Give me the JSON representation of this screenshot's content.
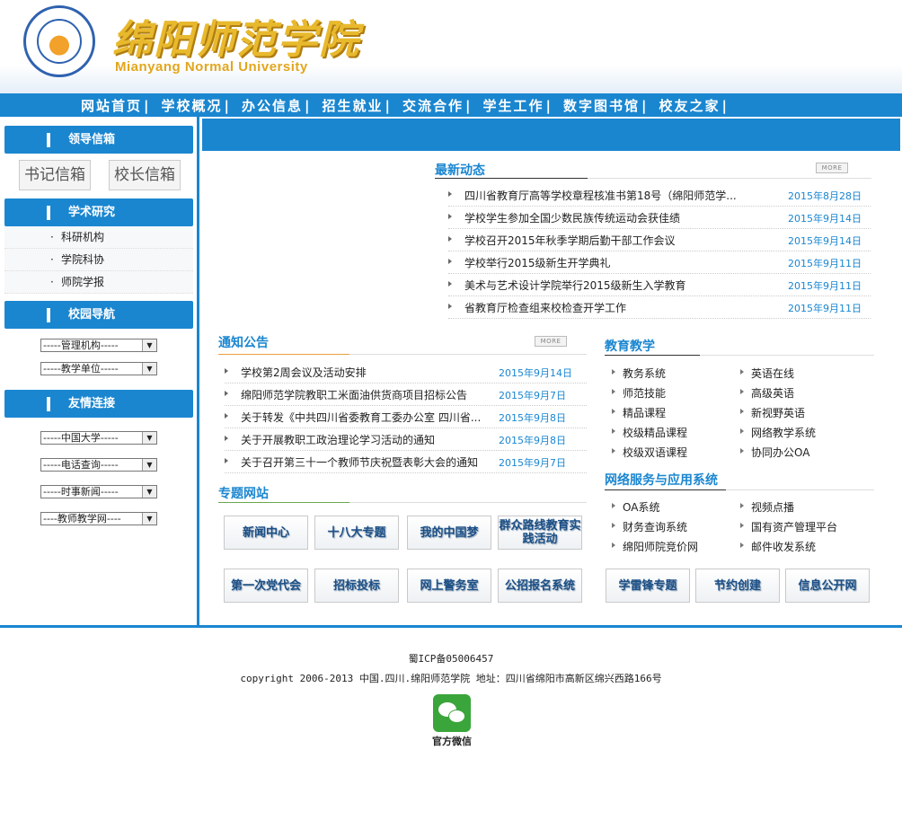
{
  "header": {
    "seal_text": "绵阳师范学院",
    "name_cn": "绵阳师范学院",
    "name_en": "Mianyang Normal University"
  },
  "nav": [
    "网站首页",
    "学校概况",
    "办公信息",
    "招生就业",
    "交流合作",
    "学生工作",
    "数字图书馆",
    "校友之家"
  ],
  "nav_separator": "|",
  "sidebar": {
    "leaders_title": "领导信箱",
    "mailbox_secretary": "书记信箱",
    "mailbox_president": "校长信箱",
    "research_title": "学术研究",
    "research_items": [
      "科研机构",
      "学院科协",
      "师院学报"
    ],
    "campus_nav_title": "校园导航",
    "campus_selects": [
      "-----管理机构-----",
      "-----教学单位-----"
    ],
    "links_title": "友情连接",
    "link_selects": [
      "-----中国大学-----",
      "-----电话查询-----",
      "-----时事新闻-----",
      "----教师教学网----"
    ]
  },
  "latest": {
    "title": "最新动态",
    "more": "MORE",
    "items": [
      {
        "title": "四川省教育厅高等学校章程核准书第18号（绵阳师范学...",
        "date": "2015年8月28日"
      },
      {
        "title": "学校学生参加全国少数民族传统运动会获佳绩",
        "date": "2015年9月14日"
      },
      {
        "title": "学校召开2015年秋季学期后勤干部工作会议",
        "date": "2015年9月14日"
      },
      {
        "title": "学校举行2015级新生开学典礼",
        "date": "2015年9月11日"
      },
      {
        "title": "美术与艺术设计学院举行2015级新生入学教育",
        "date": "2015年9月11日"
      },
      {
        "title": "省教育厅检查组来校检查开学工作",
        "date": "2015年9月11日"
      }
    ]
  },
  "notices": {
    "title": "通知公告",
    "more": "MORE",
    "items": [
      {
        "title": "学校第2周会议及活动安排",
        "date": "2015年9月14日"
      },
      {
        "title": "绵阳师范学院教职工米面油供货商项目招标公告",
        "date": "2015年9月7日"
      },
      {
        "title": "关于转发《中共四川省委教育工委办公室 四川省...",
        "date": "2015年9月8日"
      },
      {
        "title": "关于开展教职工政治理论学习活动的通知",
        "date": "2015年9月8日"
      },
      {
        "title": "关于召开第三十一个教师节庆祝暨表彰大会的通知",
        "date": "2015年9月7日"
      }
    ]
  },
  "teaching": {
    "title": "教育教学",
    "col1": [
      "教务系统",
      "师范技能",
      "精品课程",
      "校级精品课程",
      "校级双语课程"
    ],
    "col2": [
      "英语在线",
      "高级英语",
      "新视野英语",
      "网络教学系统",
      "协同办公OA"
    ]
  },
  "services": {
    "title": "网络服务与应用系统",
    "col1": [
      "OA系统",
      "财务查询系统",
      "绵阳师院竞价网"
    ],
    "col2": [
      "视频点播",
      "国有资产管理平台",
      "邮件收发系统"
    ]
  },
  "topics": {
    "title": "专题网站",
    "row1": [
      "新闻中心",
      "十八大专题",
      "我的中国梦",
      "群众路线教育实践活动"
    ],
    "row2": [
      "第一次党代会",
      "招标投标",
      "网上警务室",
      "公招报名系统"
    ]
  },
  "right_buttons": [
    "学雷锋专题",
    "节约创建",
    "信息公开网"
  ],
  "footer": {
    "icp": "蜀ICP备05006457",
    "copyright": "copyright 2006-2013 中国.四川.绵阳师范学院  地址：四川省绵阳市高新区绵兴西路166号",
    "wechat_label": "官方微信"
  },
  "colors": {
    "accent": "#1a86d0",
    "logo_gold": "#e8b92d"
  }
}
